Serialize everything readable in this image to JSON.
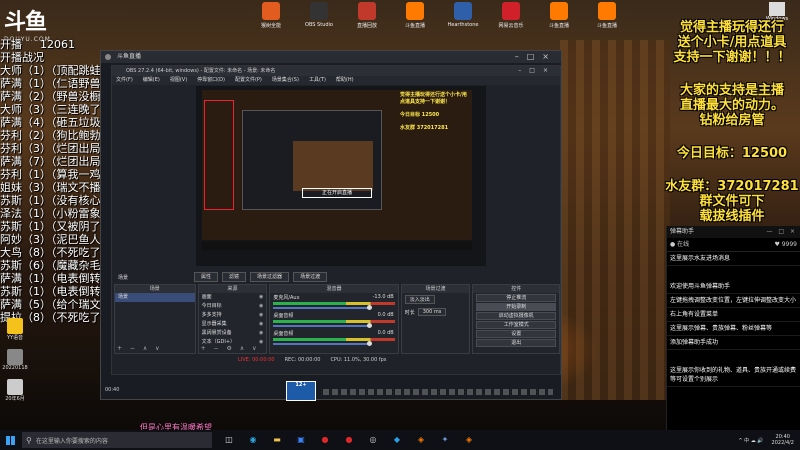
{
  "logo": {
    "mark": "斗鱼",
    "sub": "DOUYU.COM"
  },
  "left_overlay": {
    "lines": [
      {
        "text": "开播战况"
      },
      {
        "text": "大师（1）（顶配跳蛙）"
      },
      {
        "text": "萨满（1）（仁语野兽）"
      },
      {
        "text": "萨满（2）（野兽没橱）"
      },
      {
        "text": "大师（3）（三连晚了）"
      },
      {
        "text": "萨满（4）（砸五垃圾）"
      },
      {
        "text": "芬利（2）（狗比鲍勃）"
      },
      {
        "text": "芬利（3）（烂团出局）"
      },
      {
        "text": "萨满（7）（烂团出局）"
      },
      {
        "text": "芬利（1）（算我一鸡）"
      },
      {
        "text": "姐妹（3）（瑞文不播）"
      },
      {
        "text": "苏斯（1）（没有核心）"
      },
      {
        "text": "泽法（1）（小粉雷象）"
      },
      {
        "text": "苏斯（1）（又被阴了）"
      },
      {
        "text": "阿妙（3）（泥巴鱼人）"
      },
      {
        "text": "大鸟（8）（不死吃了）"
      },
      {
        "text": "苏斯（6）（魔藏杂毛）"
      },
      {
        "text": "萨满（1）（电表倒转）"
      },
      {
        "text": "苏斯（1）（电表倒转）"
      },
      {
        "text": "萨满（5）（给个瑞文）"
      },
      {
        "text": "提拉（8）（不死吃了）"
      }
    ],
    "stat_label": "开播",
    "stat_value": "12061"
  },
  "desktop_icons": [
    {
      "label": "猴树全能",
      "color": "#e25c1f"
    },
    {
      "label": "OBS Studio",
      "color": "#333333"
    },
    {
      "label": "直播回放",
      "color": "#c0392b"
    },
    {
      "label": "斗鱼直播",
      "color": "#ff7a00"
    },
    {
      "label": "Hearthstone",
      "color": "#2f5fa8"
    },
    {
      "label": "网易云音乐",
      "color": "#d0202a"
    },
    {
      "label": "斗鱼直播",
      "color": "#ff7a00"
    },
    {
      "label": "斗鱼直播",
      "color": "#ff7a00"
    }
  ],
  "win_icon_label": "Windows",
  "left_icons": [
    {
      "label": "YY语音",
      "color": "#f4c21b"
    },
    {
      "label": "20220118",
      "color": "#888888"
    },
    {
      "label": "20年6月",
      "color": "#cccccc"
    }
  ],
  "obs": {
    "outer_title": "斗鱼直播",
    "inner_title": "OBS 27.2.4 (64-bit, windows) - 配置文件: 未命名 - 场景: 未命名",
    "menu": [
      "文件(F)",
      "编辑(E)",
      "视图(V)",
      "停靠窗口(D)",
      "配置文件(P)",
      "场景集合(S)",
      "工具(T)",
      "帮助(H)"
    ],
    "preview_yellow": "觉得主播玩得还行送个小卡/用点道具支持一下谢谢！",
    "preview_box": "今日目标 12500",
    "preview_box2": "水友群 372017281",
    "preview_bottom": "正在开启直播",
    "scene_name": "场景",
    "scene_buttons": [
      "属性",
      "滤镜",
      "场景过滤器",
      "场景过渡"
    ],
    "docks": {
      "scenes": {
        "title": "场景",
        "items": [
          "场景"
        ]
      },
      "sources": {
        "title": "来源",
        "items": [
          "画面",
          "今日目标",
          "多多支持",
          "显示器采集",
          "黑阔悬赏设备",
          "文本（GDI+）"
        ]
      },
      "mixer": {
        "title": "混音器",
        "items": [
          {
            "name": "麦克风/Aux",
            "db": "-13.0 dB"
          },
          {
            "name": "桌面音频",
            "db": "0.0 dB"
          },
          {
            "name": "桌面音频",
            "db": "0.0 dB"
          }
        ]
      },
      "transitions": {
        "title": "场景过渡",
        "type": "淡入淡出",
        "duration_label": "时长",
        "duration": "300 ms"
      },
      "controls": {
        "title": "控件",
        "buttons": [
          "停止推流",
          "开始录制",
          "启动虚拟摄像机",
          "工作室模式",
          "设置",
          "退出"
        ]
      }
    },
    "status": {
      "live": "LIVE: 00:00:00",
      "rec": "REC: 00:00:00",
      "cpu": "CPU: 11.0%, 30.00 fps"
    },
    "clock": "00:40",
    "caption": "12+"
  },
  "right_overlay": {
    "lines": [
      {
        "text": "觉得主播玩得还行"
      },
      {
        "text": "送个小卡/用点道具"
      },
      {
        "text": "支持一下谢谢！！！"
      }
    ],
    "lines2": [
      {
        "text": "大家的支持是主播"
      },
      {
        "text": "直播最大的动力。"
      },
      {
        "text": "钻粉给房管"
      }
    ],
    "target": "今日目标：12500",
    "lines3": [
      {
        "text": "水友群：372017281"
      },
      {
        "text": "群文件可下"
      },
      {
        "text": "载拔线插件"
      }
    ]
  },
  "chat": {
    "header": "弹幕助手",
    "header_right": "— □ ×",
    "sub_left": "● 在线",
    "sub_right": "♥ 9999",
    "messages": [
      "这里展示水友进场消息",
      "欢迎使用斗鱼弹幕助手",
      "左键拖拽调整改变位置，左键拉伸调整改变大小",
      "右上角有设置菜单",
      "这里展示弹幕、贵族弹幕、粉丝弹幕等",
      "添加弹幕助手成功",
      "这里展示你收到的礼物、道具、贵族开通或续费等可设置个别展示"
    ]
  },
  "subtitle": "但是心里有温暖希望",
  "taskbar": {
    "search_placeholder": "在这里输入你要搜索的内容",
    "apps": [
      {
        "name": "task-view",
        "glyph": "◫",
        "color": "#dddddd"
      },
      {
        "name": "edge",
        "glyph": "◉",
        "color": "#2fa7e0"
      },
      {
        "name": "file-explorer",
        "glyph": "▬",
        "color": "#f2c14e"
      },
      {
        "name": "store",
        "glyph": "▣",
        "color": "#3b82f6"
      },
      {
        "name": "netease-music",
        "glyph": "●",
        "color": "#e02828"
      },
      {
        "name": "netease",
        "glyph": "●",
        "color": "#e02828"
      },
      {
        "name": "obs",
        "glyph": "◎",
        "color": "#cccccc"
      },
      {
        "name": "qq",
        "glyph": "◆",
        "color": "#29a0e8"
      },
      {
        "name": "douyu",
        "glyph": "◈",
        "color": "#ff7a00"
      },
      {
        "name": "hearthstone",
        "glyph": "✦",
        "color": "#6f9fdb"
      },
      {
        "name": "douyu-live",
        "glyph": "◈",
        "color": "#ff7a00"
      }
    ],
    "tray_text": "^ 中 ☁ 🔊",
    "time": "20:40",
    "date": "2022/4/2"
  }
}
